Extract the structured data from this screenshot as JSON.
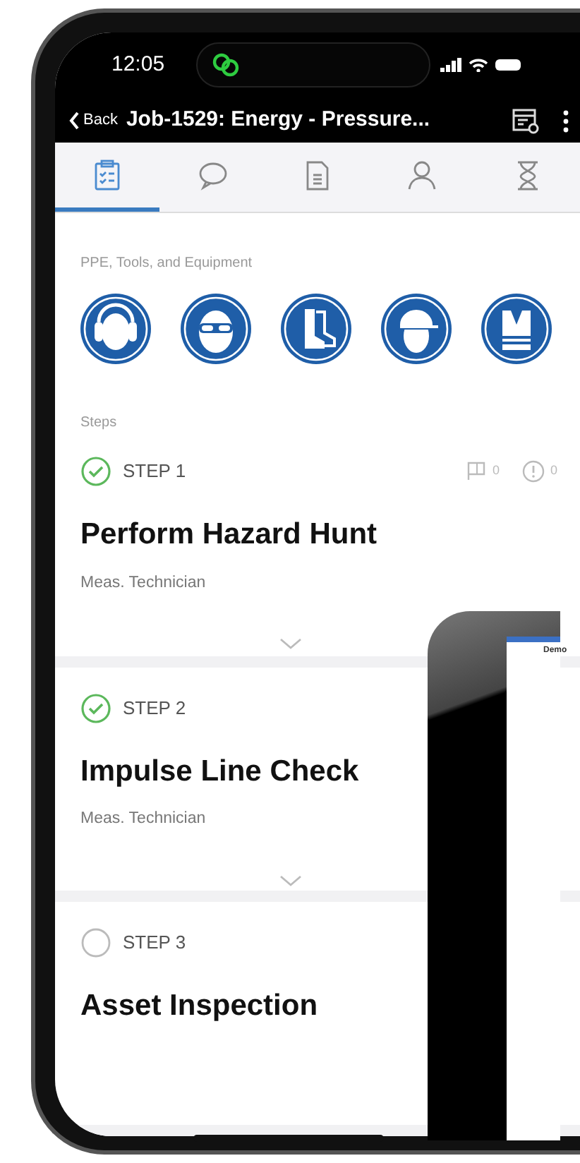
{
  "status_bar": {
    "time": "12:05"
  },
  "header": {
    "back": "Back",
    "title": "Job-1529: Energy - Pressure..."
  },
  "tabs": [
    {
      "kind": "checklist",
      "selected": true
    },
    {
      "kind": "comment",
      "selected": false
    },
    {
      "kind": "document",
      "selected": false
    },
    {
      "kind": "person",
      "selected": false
    },
    {
      "kind": "hourglass",
      "selected": false
    }
  ],
  "ppe": {
    "label": "PPE, Tools, and Equipment",
    "items": [
      {
        "kind": "ear"
      },
      {
        "kind": "goggles"
      },
      {
        "kind": "boots"
      },
      {
        "kind": "helmet"
      },
      {
        "kind": "vest"
      }
    ]
  },
  "steps": {
    "label": "Steps",
    "items": [
      {
        "number": "STEP 1",
        "title": "Perform Hazard Hunt",
        "role": "Meas. Technician",
        "completed": true,
        "flags": "0",
        "issues": "0"
      },
      {
        "number": "STEP 2",
        "title": "Impulse Line Check",
        "role": "Meas. Technician",
        "completed": true
      },
      {
        "number": "STEP 3",
        "title": "Asset Inspection",
        "completed": false
      }
    ]
  },
  "tablet": {
    "title": "Demo"
  }
}
